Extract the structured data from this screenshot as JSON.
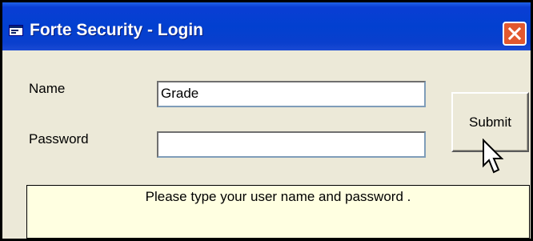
{
  "window": {
    "title": "Forte Security - Login",
    "title_icon": "window-app-icon",
    "close_icon": "close-icon"
  },
  "form": {
    "name_label": "Name",
    "name_value": "Grade",
    "password_label": "Password",
    "password_value": "",
    "submit_label": "Submit"
  },
  "status": {
    "message": "Please type your user name and password ."
  },
  "colors": {
    "titlebar": "#0240d0",
    "close_button": "#e2582f",
    "dialog_background": "#ece9d8",
    "status_background": "#ffffe1"
  }
}
